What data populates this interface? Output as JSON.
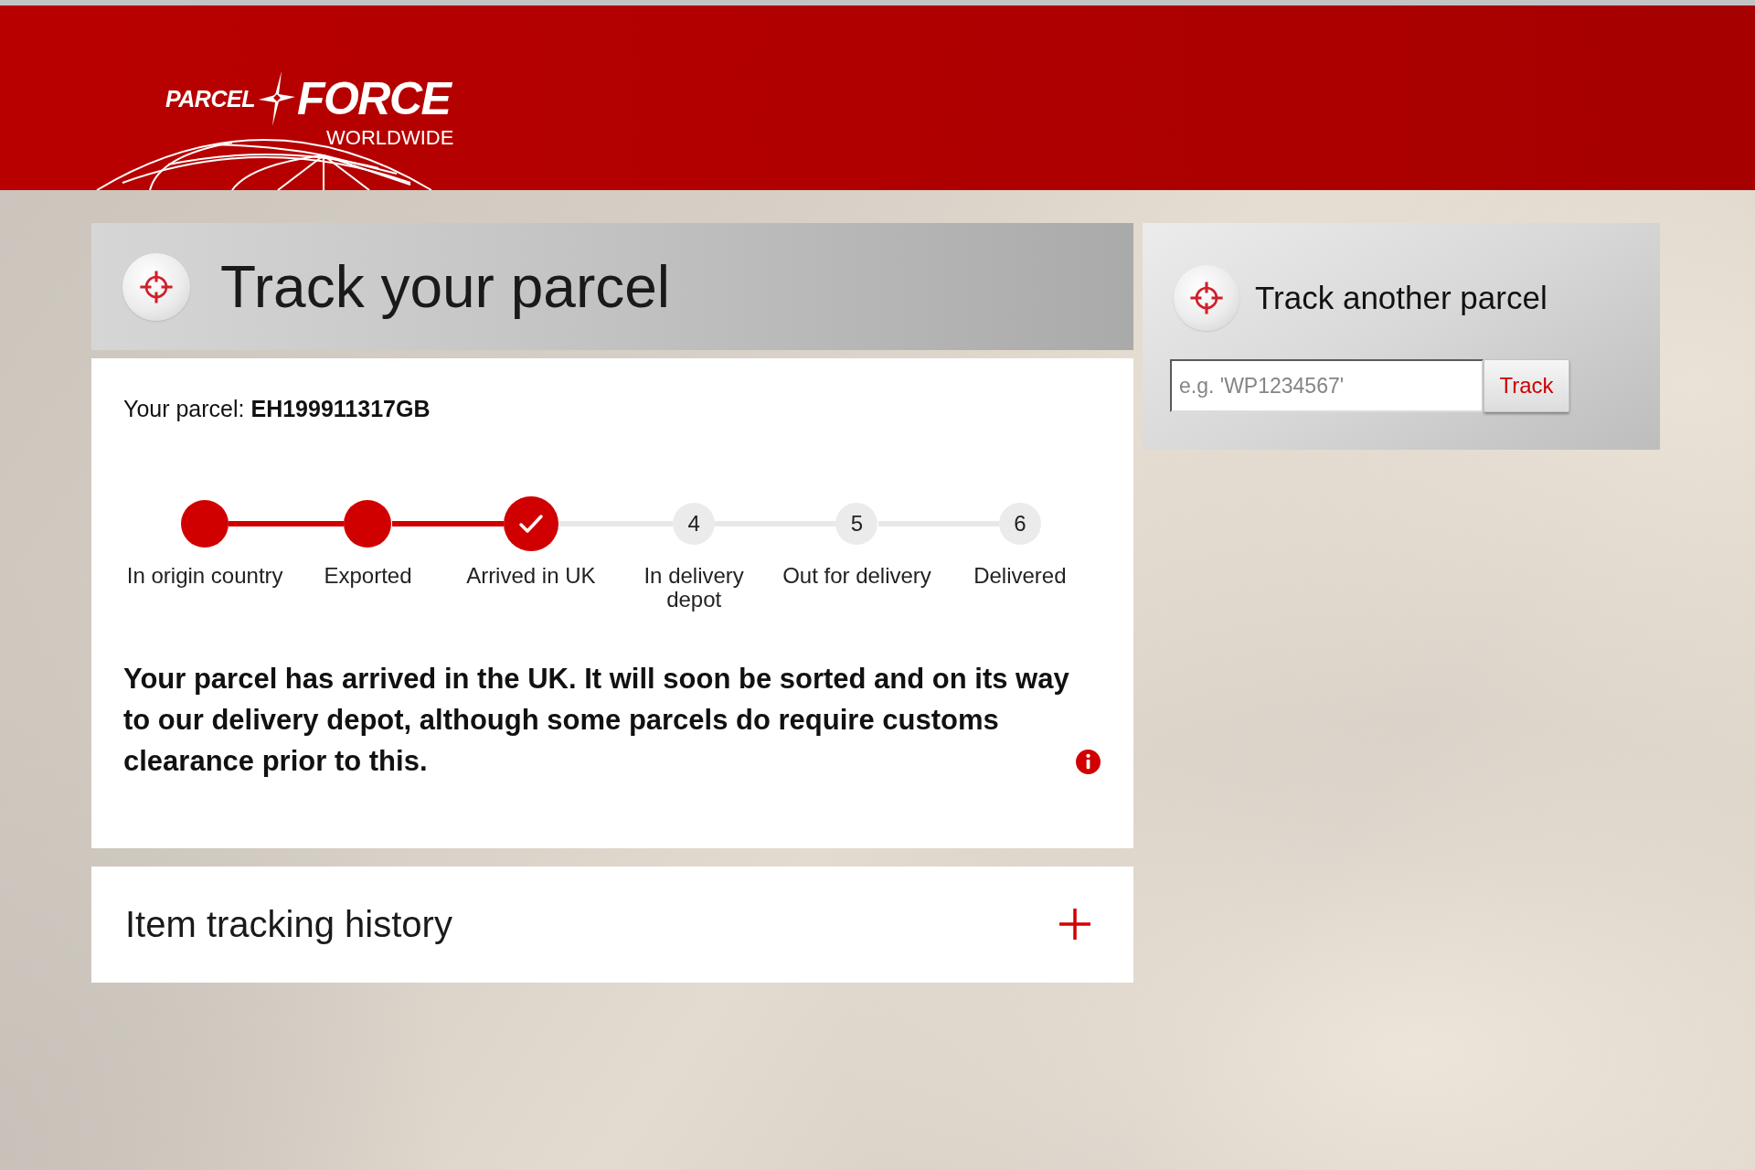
{
  "header": {
    "logo": {
      "left_word": "PARCEL",
      "right_word": "FORCE",
      "tagline": "WORLDWIDE"
    }
  },
  "main": {
    "tracking_card": {
      "title": "Track your parcel",
      "parcel": "Your parcel: **EH199911317GB**",
      "steps": [
        {
          "label": "In origin country",
          "reached": true,
          "current": false
        },
        {
          "label": "Exported",
          "reached": true,
          "current": false
        },
        {
          "label": "Arrived in UK",
          "reached": true,
          "current": true
        },
        {
          "label": "In delivery depot",
          "number": "4",
          "reached": false,
          "current": false
        },
        {
          "label": "Out for delivery",
          "number": "5",
          "reached": false,
          "current": false
        },
        {
          "label": "Delivered",
          "number": "6",
          "reached": false,
          "current": false
        }
      ],
      "message": "Your parcel has arrived in the UK. It will soon be sorted and on its way to our delivery depot, although some parcels do require customs clearance prior to this."
    },
    "history": {
      "title": "Item tracking history",
      "expanded": false
    }
  },
  "sidebar": {
    "track_another": {
      "title": "Track another parcel",
      "input": {
        "placeholder": "e.g. 'WP1234567'"
      },
      "button": "Track"
    }
  }
}
